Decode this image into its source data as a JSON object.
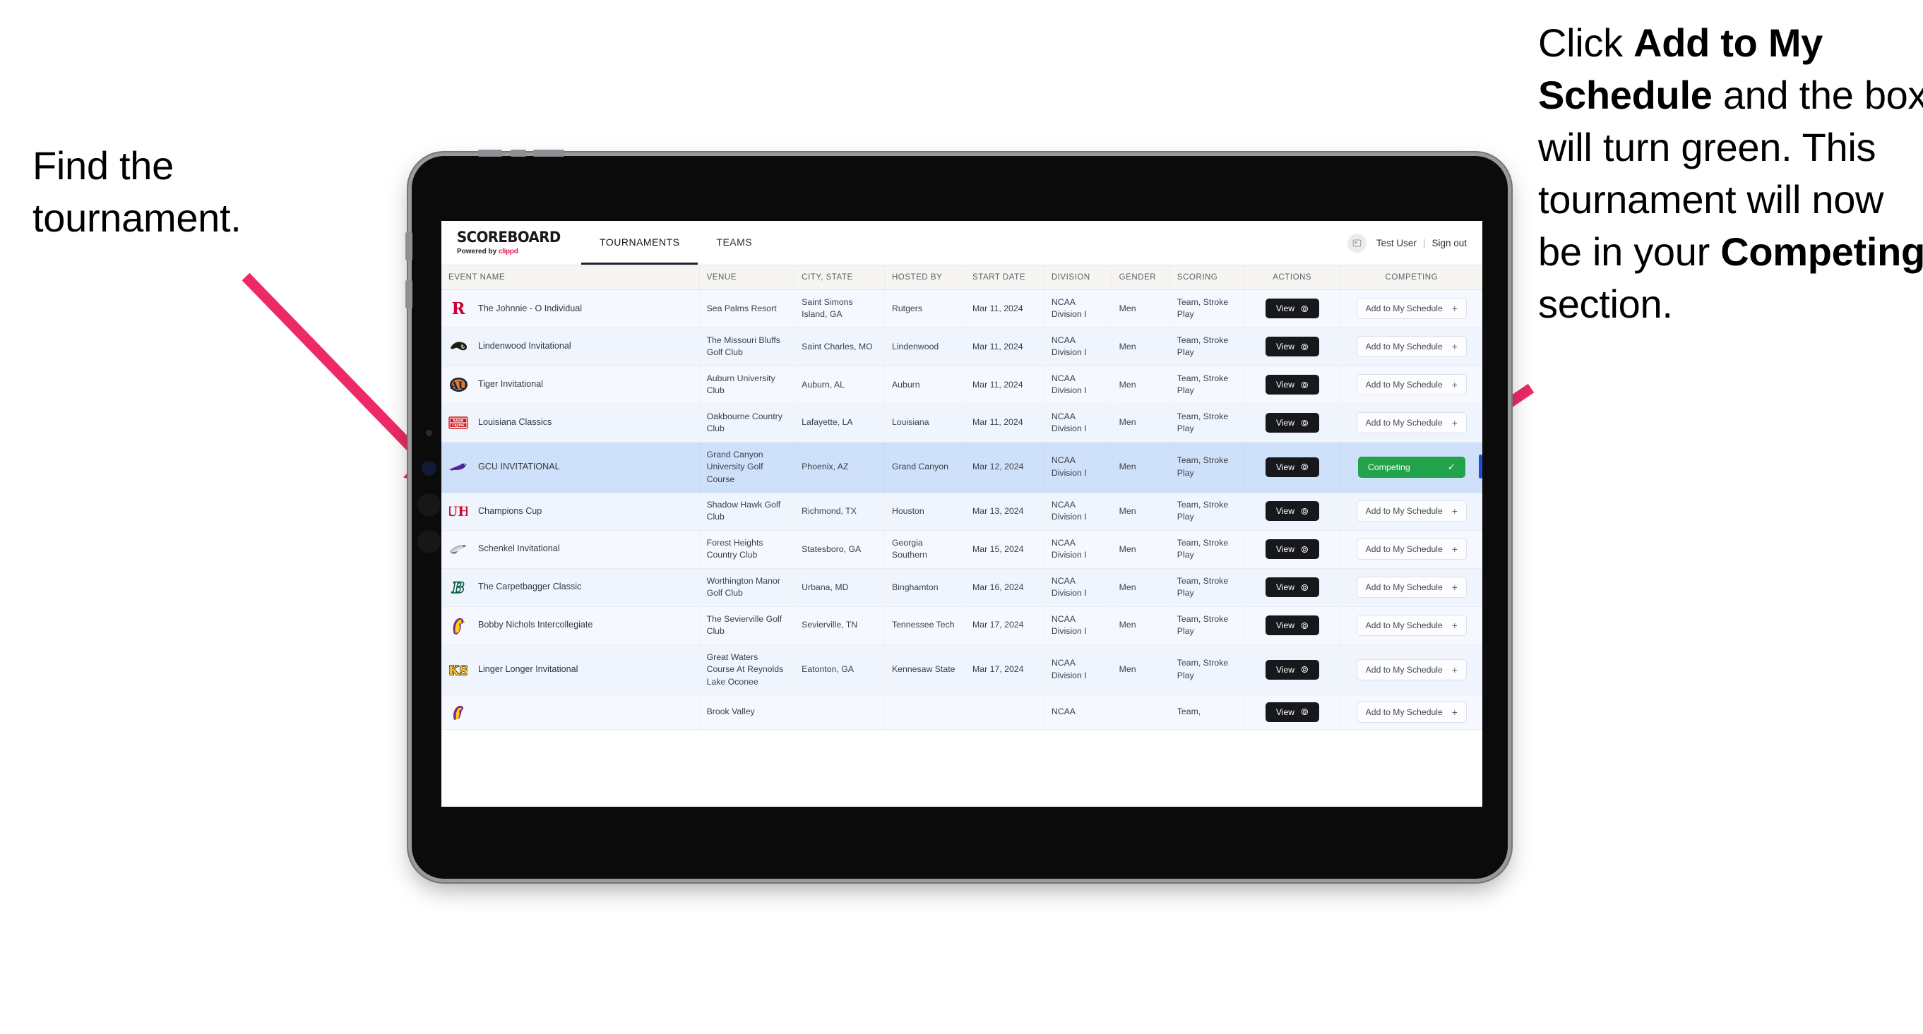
{
  "annotations": {
    "left": {
      "line1": "Find the",
      "line2": "tournament."
    },
    "right": {
      "part1": "Click ",
      "bold1": "Add to My Schedule",
      "part2": " and the box will turn green. This tournament will now be in your ",
      "bold2": "Competing",
      "part3": " section."
    },
    "arrow_color": "#ED2A63"
  },
  "app": {
    "brand": {
      "title": "SCOREBOARD",
      "powered_prefix": "Powered by ",
      "powered_name": "clippd"
    },
    "tabs": [
      {
        "label": "TOURNAMENTS",
        "active": true
      },
      {
        "label": "TEAMS",
        "active": false
      }
    ],
    "account": {
      "avatar_icon": "user-avatar-icon",
      "user": "Test User",
      "separator": "|",
      "signout": "Sign out"
    },
    "table": {
      "columns": [
        "EVENT NAME",
        "VENUE",
        "CITY, STATE",
        "HOSTED BY",
        "START DATE",
        "DIVISION",
        "GENDER",
        "SCORING",
        "ACTIONS",
        "COMPETING"
      ],
      "buttons": {
        "view": "View",
        "view_icon": "arrow-right-circle-icon",
        "add": "Add to My Schedule",
        "add_icon": "plus-icon",
        "competing": "Competing",
        "competing_icon": "check-icon"
      },
      "rows": [
        {
          "logo": "rutgers-logo",
          "event": "The Johnnie - O Individual",
          "venue": "Sea Palms Resort",
          "city": "Saint Simons Island, GA",
          "host": "Rutgers",
          "date": "Mar 11, 2024",
          "division": "NCAA Division I",
          "gender": "Men",
          "scoring": "Team, Stroke Play",
          "competing": false
        },
        {
          "logo": "lindenwood-logo",
          "event": "Lindenwood Invitational",
          "venue": "The Missouri Bluffs Golf Club",
          "city": "Saint Charles, MO",
          "host": "Lindenwood",
          "date": "Mar 11, 2024",
          "division": "NCAA Division I",
          "gender": "Men",
          "scoring": "Team, Stroke Play",
          "competing": false
        },
        {
          "logo": "auburn-logo",
          "event": "Tiger Invitational",
          "venue": "Auburn University Club",
          "city": "Auburn, AL",
          "host": "Auburn",
          "date": "Mar 11, 2024",
          "division": "NCAA Division I",
          "gender": "Men",
          "scoring": "Team, Stroke Play",
          "competing": false
        },
        {
          "logo": "louisiana-logo",
          "event": "Louisiana Classics",
          "venue": "Oakbourne Country Club",
          "city": "Lafayette, LA",
          "host": "Louisiana",
          "date": "Mar 11, 2024",
          "division": "NCAA Division I",
          "gender": "Men",
          "scoring": "Team, Stroke Play",
          "competing": false
        },
        {
          "logo": "gcu-logo",
          "event": "GCU INVITATIONAL",
          "venue": "Grand Canyon University Golf Course",
          "city": "Phoenix, AZ",
          "host": "Grand Canyon",
          "date": "Mar 12, 2024",
          "division": "NCAA Division I",
          "gender": "Men",
          "scoring": "Team, Stroke Play",
          "competing": true
        },
        {
          "logo": "houston-logo",
          "event": "Champions Cup",
          "venue": "Shadow Hawk Golf Club",
          "city": "Richmond, TX",
          "host": "Houston",
          "date": "Mar 13, 2024",
          "division": "NCAA Division I",
          "gender": "Men",
          "scoring": "Team, Stroke Play",
          "competing": false
        },
        {
          "logo": "georgia-southern-logo",
          "event": "Schenkel Invitational",
          "venue": "Forest Heights Country Club",
          "city": "Statesboro, GA",
          "host": "Georgia Southern",
          "date": "Mar 15, 2024",
          "division": "NCAA Division I",
          "gender": "Men",
          "scoring": "Team, Stroke Play",
          "competing": false
        },
        {
          "logo": "binghamton-logo",
          "event": "The Carpetbagger Classic",
          "venue": "Worthington Manor Golf Club",
          "city": "Urbana, MD",
          "host": "Binghamton",
          "date": "Mar 16, 2024",
          "division": "NCAA Division I",
          "gender": "Men",
          "scoring": "Team, Stroke Play",
          "competing": false
        },
        {
          "logo": "tennessee-tech-logo",
          "event": "Bobby Nichols Intercollegiate",
          "venue": "The Sevierville Golf Club",
          "city": "Sevierville, TN",
          "host": "Tennessee Tech",
          "date": "Mar 17, 2024",
          "division": "NCAA Division I",
          "gender": "Men",
          "scoring": "Team, Stroke Play",
          "competing": false
        },
        {
          "logo": "kennesaw-state-logo",
          "event": "Linger Longer Invitational",
          "venue": "Great Waters Course At Reynolds Lake Oconee",
          "city": "Eatonton, GA",
          "host": "Kennesaw State",
          "date": "Mar 17, 2024",
          "division": "NCAA Division I",
          "gender": "Men",
          "scoring": "Team, Stroke Play",
          "competing": false
        },
        {
          "logo": "partial-logo",
          "event": "",
          "venue": "Brook Valley",
          "city": "",
          "host": "",
          "date": "",
          "division": "NCAA",
          "gender": "",
          "scoring": "Team,",
          "competing": false,
          "partial": true
        }
      ]
    }
  }
}
